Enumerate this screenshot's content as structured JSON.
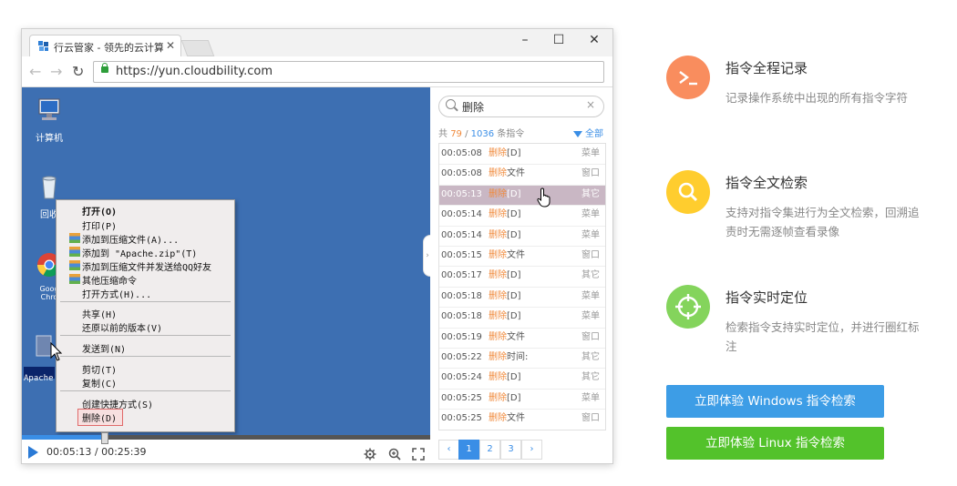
{
  "browser": {
    "tab_title": "行云管家 - 领先的云计算",
    "url": "https://yun.cloudbility.com",
    "controls": {
      "minimize": "–",
      "maximize": "☐",
      "close": "✕",
      "tab_close": "✕"
    },
    "nav": {
      "back": "←",
      "forward": "→",
      "reload": "↻"
    }
  },
  "desktop": {
    "icons": [
      {
        "label": "计算机"
      },
      {
        "label": "回收"
      },
      {
        "label": "Goog Chro"
      },
      {
        "label": "Apache"
      }
    ],
    "context_menu": [
      "打开(O)",
      "打印(P)",
      "添加到压缩文件(A)...",
      "添加到 \"Apache.zip\"(T)",
      "添加到压缩文件并发送给QQ好友",
      "其他压缩命令",
      "打开方式(H)...",
      "共享(H)",
      "还原以前的版本(V)",
      "发送到(N)",
      "剪切(T)",
      "复制(C)",
      "创建快捷方式(S)",
      "删除(D)"
    ]
  },
  "player": {
    "time": "00:05:13 / 00:25:39",
    "progress": 0.203,
    "icons": [
      "gear-icon",
      "zoom-icon",
      "fullscreen-icon"
    ]
  },
  "panel": {
    "search_value": "删除",
    "clear": "×",
    "count_prefix": "共",
    "count_found": "79",
    "count_sep": "/",
    "count_total": "1036",
    "count_suffix": "条指令",
    "filter_label": "全部",
    "expand": "›",
    "rows": [
      {
        "time": "00:05:08",
        "cmd": "删除",
        "arg": "[D]",
        "type": "菜单"
      },
      {
        "time": "00:05:08",
        "cmd": "删除",
        "arg": "文件",
        "type": "窗口"
      },
      {
        "time": "00:05:13",
        "cmd": "删除",
        "arg": "[D]",
        "type": "其它"
      },
      {
        "time": "00:05:14",
        "cmd": "删除",
        "arg": "[D]",
        "type": "菜单"
      },
      {
        "time": "00:05:14",
        "cmd": "删除",
        "arg": "[D]",
        "type": "菜单"
      },
      {
        "time": "00:05:15",
        "cmd": "删除",
        "arg": "文件",
        "type": "窗口"
      },
      {
        "time": "00:05:17",
        "cmd": "删除",
        "arg": "[D]",
        "type": "其它"
      },
      {
        "time": "00:05:18",
        "cmd": "删除",
        "arg": "[D]",
        "type": "菜单"
      },
      {
        "time": "00:05:18",
        "cmd": "删除",
        "arg": "[D]",
        "type": "菜单"
      },
      {
        "time": "00:05:19",
        "cmd": "删除",
        "arg": "文件",
        "type": "窗口"
      },
      {
        "time": "00:05:22",
        "cmd": "删除",
        "arg": "时间:",
        "type": "其它"
      },
      {
        "time": "00:05:24",
        "cmd": "删除",
        "arg": "[D]",
        "type": "其它"
      },
      {
        "time": "00:05:25",
        "cmd": "删除",
        "arg": "[D]",
        "type": "菜单"
      },
      {
        "time": "00:05:25",
        "cmd": "删除",
        "arg": "文件",
        "type": "窗口"
      }
    ],
    "pager": {
      "prev": "‹",
      "pages": [
        "1",
        "2",
        "3"
      ],
      "next": "›"
    }
  },
  "features": [
    {
      "title": "指令全程记录",
      "desc": "记录操作系统中出现的所有指令字符",
      "color": "#f98d5e",
      "icon": "terminal-icon",
      "glyph": ">_"
    },
    {
      "title": "指令全文检索",
      "desc": "支持对指令集进行为全文检索，回溯追责时无需逐帧查看录像",
      "color": "#ffcd2e",
      "icon": "search-icon",
      "glyph": ""
    },
    {
      "title": "指令实时定位",
      "desc": "检索指令支持实时定位，并进行圈红标注",
      "color": "#84d45c",
      "icon": "crosshair-icon",
      "glyph": ""
    }
  ],
  "buttons": {
    "windows": "立即体验 Windows 指令检索",
    "linux": "立即体验 Linux 指令检索",
    "windows_color": "#3d9de6",
    "linux_color": "#53c22b"
  }
}
